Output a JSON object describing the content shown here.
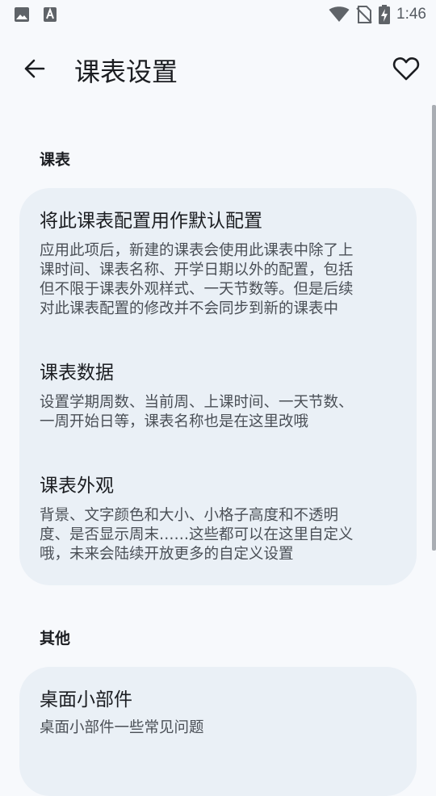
{
  "status": {
    "time": "1:46",
    "icons": [
      "image-icon",
      "text-icon",
      "wifi-icon",
      "no-sim-icon",
      "battery-charging-icon"
    ]
  },
  "appbar": {
    "title": "课表设置",
    "back_icon": "back-arrow-icon",
    "favorite_icon": "heart-icon"
  },
  "sections": [
    {
      "title": "课表",
      "items": [
        {
          "title": "将此课表配置用作默认配置",
          "desc_lines": [
            "应用此项后，新建的课表会使用此课表中除了上",
            "课时间、课表名称、开学日期以外的配置，包括",
            "但不限于课表外观样式、一天节数等。但是后续",
            "对此课表配置的修改并不会同步到新的课表中"
          ]
        },
        {
          "title": "课表数据",
          "desc_lines": [
            "设置学期周数、当前周、上课时间、一天节数、",
            "一周开始日等，课表名称也是在这里改哦"
          ]
        },
        {
          "title": "课表外观",
          "desc_lines": [
            "背景、文字颜色和大小、小格子高度和不透明",
            "度、是否显示周末……这些都可以在这里自定义",
            "哦，未来会陆续开放更多的自定义设置"
          ]
        }
      ]
    },
    {
      "title": "其他",
      "items": [
        {
          "title": "桌面小部件",
          "desc_lines": [
            "桌面小部件一些常见问题"
          ]
        }
      ]
    }
  ]
}
